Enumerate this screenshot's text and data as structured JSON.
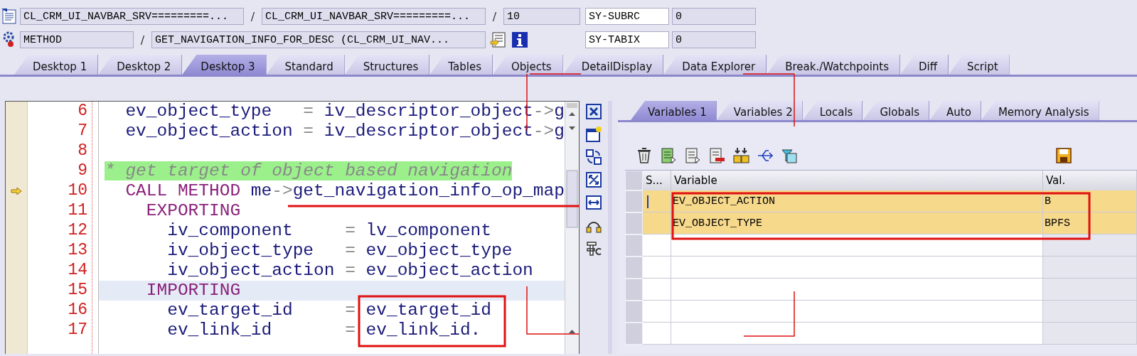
{
  "location_rows": [
    {
      "items": [
        {
          "kind": "field",
          "value": "CL_CRM_UI_NAVBAR_SRV=========..."
        },
        {
          "kind": "separator",
          "text": "/"
        },
        {
          "kind": "field",
          "value": "CL_CRM_UI_NAVBAR_SRV=========..."
        },
        {
          "kind": "separator",
          "text": "/"
        },
        {
          "kind": "field",
          "value": "10"
        }
      ],
      "system_field": {
        "name": "SY-SUBRC",
        "value": "0"
      }
    },
    {
      "items": [
        {
          "kind": "field",
          "value": "METHOD"
        },
        {
          "kind": "separator",
          "text": "/"
        },
        {
          "kind": "field",
          "value": "GET_NAVIGATION_INFO_FOR_DESC (CL_CRM_UI_NAV..."
        },
        {
          "kind": "display-button"
        },
        {
          "kind": "info-button"
        }
      ],
      "system_field": {
        "name": "SY-TABIX",
        "value": "0"
      }
    }
  ],
  "desktop_tabs": [
    {
      "label": "Desktop 1",
      "selected": false
    },
    {
      "label": "Desktop 2",
      "selected": false
    },
    {
      "label": "Desktop 3",
      "selected": true
    },
    {
      "label": "Standard",
      "selected": false
    },
    {
      "label": "Structures",
      "selected": false
    },
    {
      "label": "Tables",
      "selected": false
    },
    {
      "label": "Objects",
      "selected": false
    },
    {
      "label": "DetailDisplay",
      "selected": false
    },
    {
      "label": "Data Explorer",
      "selected": false
    },
    {
      "label": "Break./Watchpoints",
      "selected": false
    },
    {
      "label": "Diff",
      "selected": false
    },
    {
      "label": "Script",
      "selected": false
    }
  ],
  "source": {
    "lines": [
      {
        "number": "6",
        "current": false,
        "highlighted": false,
        "tokens": [
          {
            "kind": "id",
            "text": "  ev_object_type   "
          },
          {
            "kind": "op",
            "text": "="
          },
          {
            "kind": "id",
            "text": " iv_descriptor_object"
          },
          {
            "kind": "op",
            "text": "->"
          },
          {
            "kind": "id",
            "text": "g"
          }
        ]
      },
      {
        "number": "7",
        "current": false,
        "highlighted": false,
        "tokens": [
          {
            "kind": "id",
            "text": "  ev_object_action "
          },
          {
            "kind": "op",
            "text": "="
          },
          {
            "kind": "id",
            "text": " iv_descriptor_object"
          },
          {
            "kind": "op",
            "text": "->"
          },
          {
            "kind": "id",
            "text": "g"
          }
        ]
      },
      {
        "number": "8",
        "current": false,
        "highlighted": false
      },
      {
        "number": "9",
        "current": false,
        "highlighted": false,
        "tokens": [
          {
            "kind": "comment",
            "text": "* get target of object based navigation"
          }
        ]
      },
      {
        "number": "10",
        "current": true,
        "highlighted": false,
        "tokens": [
          {
            "kind": "kw",
            "text": "  CALL METHOD"
          },
          {
            "kind": "id",
            "text": " me"
          },
          {
            "kind": "op",
            "text": "->"
          },
          {
            "kind": "id",
            "text": "get_navigation_info_op_map"
          }
        ]
      },
      {
        "number": "11",
        "current": false,
        "highlighted": false,
        "tokens": [
          {
            "kind": "kw",
            "text": "    EXPORTING"
          }
        ]
      },
      {
        "number": "12",
        "current": false,
        "highlighted": false,
        "tokens": [
          {
            "kind": "id",
            "text": "      iv_component     "
          },
          {
            "kind": "op",
            "text": "="
          },
          {
            "kind": "id",
            "text": " lv_component"
          }
        ]
      },
      {
        "number": "13",
        "current": false,
        "highlighted": false,
        "tokens": [
          {
            "kind": "id",
            "text": "      iv_object_type   "
          },
          {
            "kind": "op",
            "text": "="
          },
          {
            "kind": "id",
            "text": " ev_object_type"
          }
        ]
      },
      {
        "number": "14",
        "current": false,
        "highlighted": false,
        "tokens": [
          {
            "kind": "id",
            "text": "      iv_object_action "
          },
          {
            "kind": "op",
            "text": "="
          },
          {
            "kind": "id",
            "text": " ev_object_action"
          }
        ]
      },
      {
        "number": "15",
        "current": false,
        "highlighted": true,
        "tokens": [
          {
            "kind": "kw",
            "text": "    IMPORTING"
          }
        ]
      },
      {
        "number": "16",
        "current": false,
        "highlighted": false,
        "tokens": [
          {
            "kind": "id",
            "text": "      ev_target_id     "
          },
          {
            "kind": "op",
            "text": "="
          },
          {
            "kind": "id",
            "text": " ev_target_id"
          }
        ]
      },
      {
        "number": "17",
        "current": false,
        "highlighted": false,
        "tokens": [
          {
            "kind": "id",
            "text": "      ev_link_id       "
          },
          {
            "kind": "op",
            "text": "="
          },
          {
            "kind": "id",
            "text": " ev_link_id."
          }
        ]
      }
    ]
  },
  "variable_tabs": [
    {
      "label": "Variables 1",
      "selected": true
    },
    {
      "label": "Variables 2",
      "selected": false
    },
    {
      "label": "Locals",
      "selected": false
    },
    {
      "label": "Globals",
      "selected": false
    },
    {
      "label": "Auto",
      "selected": false
    },
    {
      "label": "Memory Analysis",
      "selected": false
    }
  ],
  "variables_table": {
    "columns": [
      "S...",
      "Variable",
      "Val."
    ],
    "rows": [
      {
        "variable": "EV_OBJECT_ACTION",
        "value": "B",
        "selected": true,
        "cursor": true
      },
      {
        "variable": "EV_OBJECT_TYPE",
        "value": "BPFS",
        "selected": true,
        "cursor": false
      }
    ]
  }
}
